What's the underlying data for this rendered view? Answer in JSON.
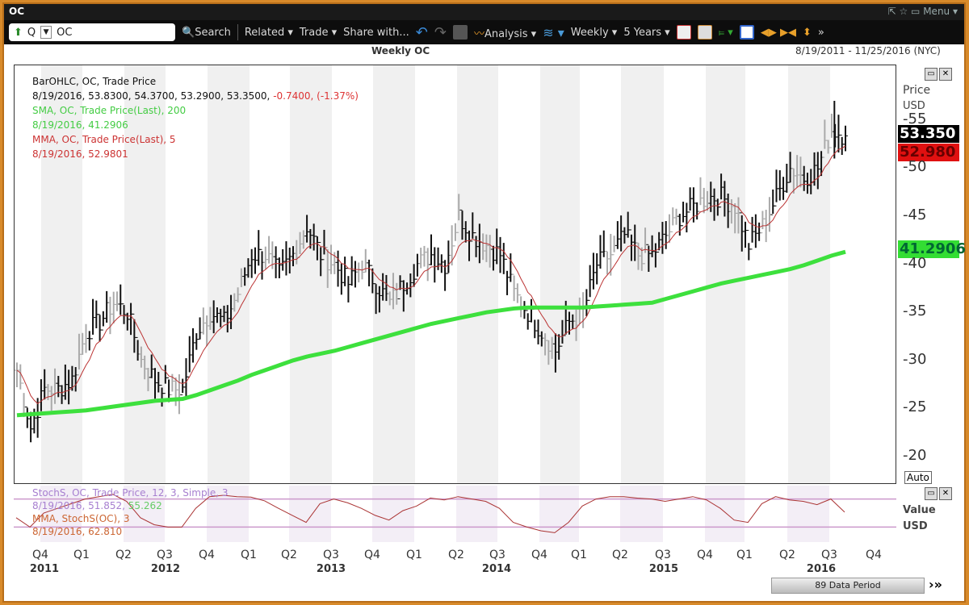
{
  "window": {
    "title": "OC",
    "controls": "⇱ ☆ ▭ Menu ▾"
  },
  "toolbar": {
    "symbol_prefix": "Q",
    "symbol": "OC",
    "search": "Search",
    "related": "Related ▾",
    "trade": "Trade ▾",
    "share": "Share with...",
    "analysis": "Analysis ▾",
    "interval": "Weekly ▾",
    "range": "5 Years ▾"
  },
  "chart": {
    "title": "Weekly OC",
    "date_range": "8/19/2011 - 11/25/2016 (NYC)",
    "legend": {
      "bar_title": "BarOHLC, OC, Trade Price",
      "bar_values": "8/19/2016, 53.8300, 54.3700, 53.2900, 53.3500,",
      "bar_change": "-0.7400, (-1.37%)",
      "sma_title": "SMA, OC, Trade Price(Last), 200",
      "sma_value": "8/19/2016, 41.2906",
      "mma_title": "MMA, OC, Trade Price(Last), 5",
      "mma_value": "8/19/2016, 52.9801"
    },
    "axis": {
      "title": "Price",
      "currency": "USD",
      "auto": "Auto",
      "ticks": [
        "20",
        "25",
        "30",
        "35",
        "40",
        "45",
        "50",
        "55"
      ],
      "last_price": "53.350",
      "mma_tag": "52.980",
      "sma_tag": "41.2906"
    },
    "stoch": {
      "title": "StochS, OC, Trade Price, 12, 3, Simple, 3",
      "values_a": "8/19/2016, 51.852,",
      "values_b": "55.262",
      "mma_title": "MMA, StochS(OC), 3",
      "mma_value": "8/19/2016, 62.810",
      "axis_title": "Value",
      "axis_currency": "USD"
    },
    "quarters": [
      "Q4",
      "Q1",
      "Q2",
      "Q3",
      "Q4",
      "Q1",
      "Q2",
      "Q3",
      "Q4",
      "Q1",
      "Q2",
      "Q3",
      "Q4",
      "Q1",
      "Q2",
      "Q3",
      "Q4",
      "Q1",
      "Q2",
      "Q3",
      "Q4"
    ],
    "years": [
      "2011",
      "2012",
      "2013",
      "2014",
      "2015",
      "2016"
    ],
    "scroll_label": "89 Data Period"
  },
  "chart_data": {
    "type": "ohlc",
    "x_start": "Aug 2011",
    "x_step": "month",
    "ylim": [
      18,
      58
    ],
    "close": [
      29,
      23,
      27,
      27,
      28,
      33,
      34,
      36,
      35,
      30,
      28,
      27,
      27,
      33,
      35,
      34,
      37,
      41,
      41,
      39,
      41,
      44,
      41,
      40,
      38,
      40,
      38,
      36,
      38,
      40,
      41,
      40,
      45,
      43,
      42,
      41,
      37,
      35,
      33,
      31,
      34,
      35,
      40,
      41,
      43,
      41,
      41,
      43,
      45,
      46,
      47,
      47,
      46,
      42,
      44,
      47,
      50,
      49,
      50,
      54,
      53.35
    ],
    "sma200": [
      24.3,
      24.4,
      24.5,
      24.6,
      24.7,
      24.8,
      25,
      25.2,
      25.4,
      25.6,
      25.8,
      25.9,
      26,
      26.4,
      26.9,
      27.4,
      27.9,
      28.5,
      29,
      29.5,
      30,
      30.4,
      30.7,
      31,
      31.4,
      31.8,
      32.2,
      32.6,
      33,
      33.4,
      33.8,
      34.1,
      34.4,
      34.7,
      35,
      35.2,
      35.4,
      35.5,
      35.5,
      35.5,
      35.5,
      35.5,
      35.6,
      35.7,
      35.8,
      35.9,
      36,
      36.4,
      36.8,
      37.2,
      37.6,
      38,
      38.3,
      38.6,
      38.9,
      39.2,
      39.5,
      39.9,
      40.4,
      40.9,
      41.29
    ],
    "stoch": [
      40,
      20,
      50,
      60,
      70,
      80,
      85,
      90,
      75,
      40,
      25,
      20,
      20,
      60,
      85,
      88,
      85,
      84,
      76,
      60,
      45,
      30,
      70,
      80,
      72,
      60,
      45,
      35,
      55,
      65,
      82,
      78,
      85,
      80,
      75,
      60,
      30,
      20,
      12,
      8,
      30,
      65,
      80,
      85,
      85,
      82,
      80,
      75,
      80,
      85,
      78,
      60,
      35,
      30,
      70,
      85,
      78,
      75,
      68,
      80,
      52
    ]
  }
}
